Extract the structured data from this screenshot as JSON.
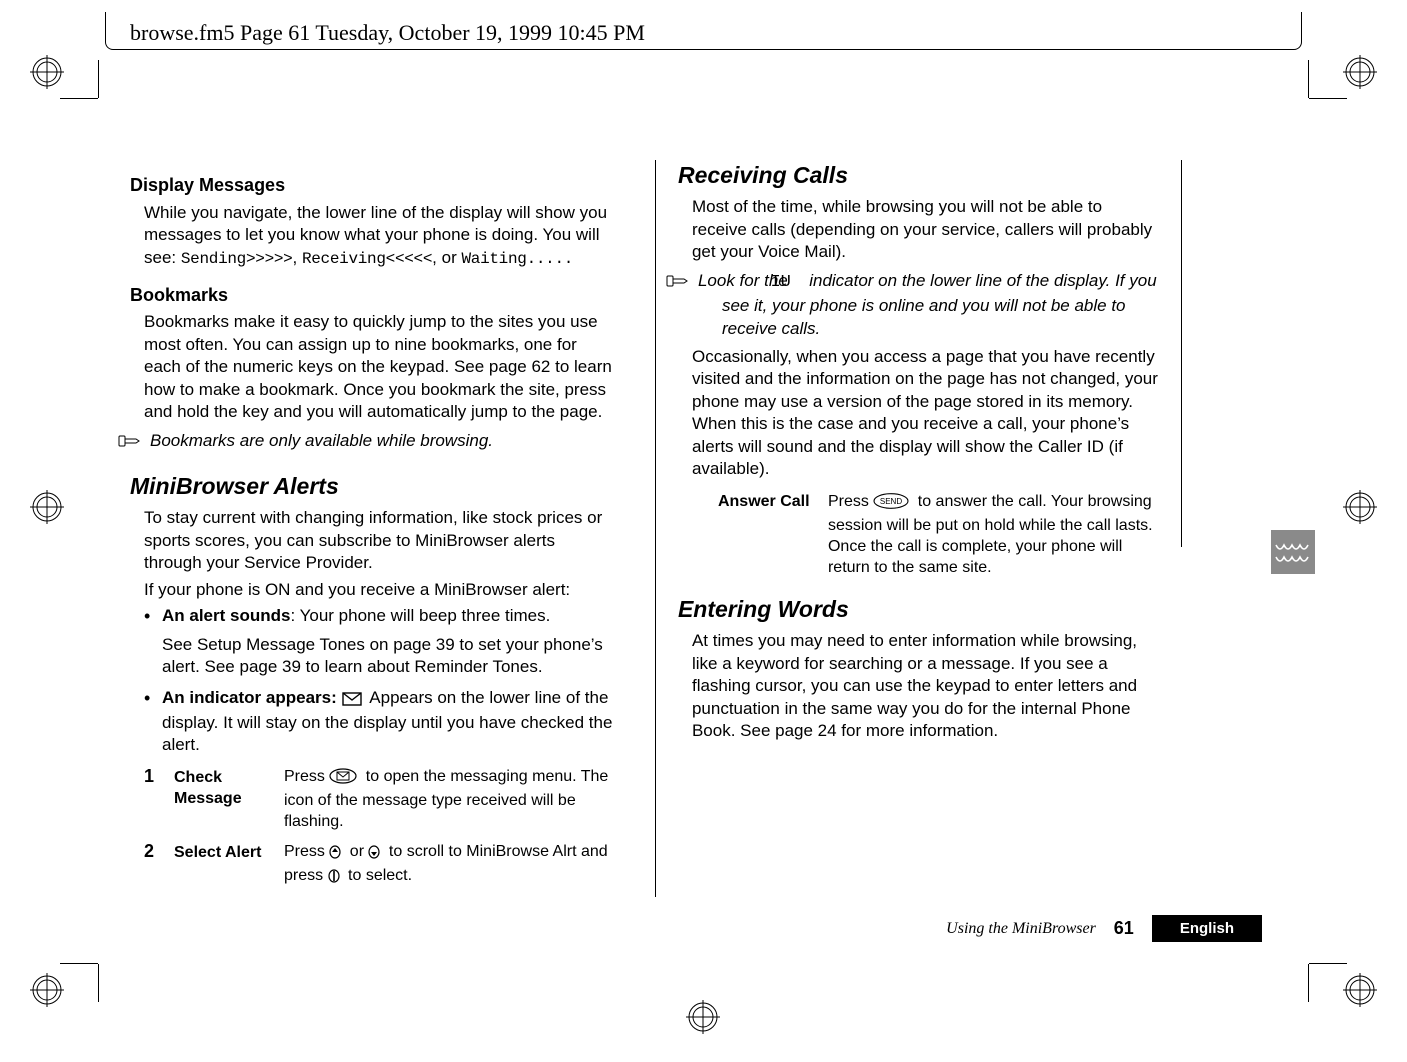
{
  "docHeader": "browse.fm5  Page 61  Tuesday, October 19, 1999  10:45 PM",
  "left": {
    "h1": "Display Messages",
    "p1a": "While you navigate, the lower line of the display will show you messages to let you know what your phone is doing. You will see: ",
    "p1code1": "Sending>>>>>",
    "p1mid1": ", ",
    "p1code2": "Receiving<<<<<",
    "p1mid2": ", or ",
    "p1code3": "Waiting.....",
    "h2": "Bookmarks",
    "p2": "Bookmarks make it easy to quickly jump to the sites you use most often. You can assign up to nine bookmarks, one for each of the numeric keys on the keypad. See page 62 to learn how to make a bookmark. Once you bookmark the site, press and hold the key and you will automatically jump to the page.",
    "note1": "Bookmarks are only available while browsing.",
    "h3": "MiniBrowser Alerts",
    "p3": "To stay current with changing information, like stock prices or sports scores, you can subscribe to MiniBrowser alerts through your Service Provider.",
    "p4": "If your phone is ON and you receive a MiniBrowser alert:",
    "b1_strong": "An alert sounds",
    "b1_rest": ": Your phone will beep three times.",
    "b1_sub": "See Setup Message Tones on page 39 to set your phone’s alert. See page 39 to learn about Reminder Tones.",
    "b2_strong": "An indicator appears:",
    "b2_rest": " Appears on the lower line of the display. It will stay on the display until you have checked the alert.",
    "step1_num": "1",
    "step1_label": "Check Message",
    "step1_body_a": "Press ",
    "step1_body_b": " to open the messaging menu. The icon of the message type received will be flashing.",
    "step2_num": "2",
    "step2_label": "Select Alert",
    "step2_body_a": "Press ",
    "step2_body_mid": " or ",
    "step2_body_b": " to scroll to MiniBrowse Alrt and press ",
    "step2_body_c": " to select."
  },
  "right": {
    "h1": "Receiving Calls",
    "p1": "Most of the time, while browsing you will not be able to receive calls (depending on your service, callers will probably get your Voice Mail).",
    "note_a": "Look for the ",
    "note_glyph": "IU",
    "note_b": " indicator on the lower line of the display. If you see it, your phone is online and you will not be able to receive calls.",
    "p2": "Occasionally, when you access a page that you have recently visited and the information on the page has not changed, your phone may use a version of the page stored in its memory. When this is the case and you receive a call, your phone’s alerts will sound and the display will show the Caller ID (if available).",
    "ans_label": "Answer Call",
    "ans_body_a": "Press ",
    "ans_body_b": " to answer the call. Your browsing session will be put on hold while the call lasts. Once the call is complete, your phone will return to the same site.",
    "h2": "Entering Words",
    "p3": "At times you may need to enter information while browsing, like a keyword for searching or a message. If you see a flashing cursor, you can use the keypad to enter letters and punctuation in the same way you do for the internal Phone Book. See page 24 for more information."
  },
  "footer": {
    "section": "Using the MiniBrowser",
    "page": "61",
    "lang": "English"
  }
}
